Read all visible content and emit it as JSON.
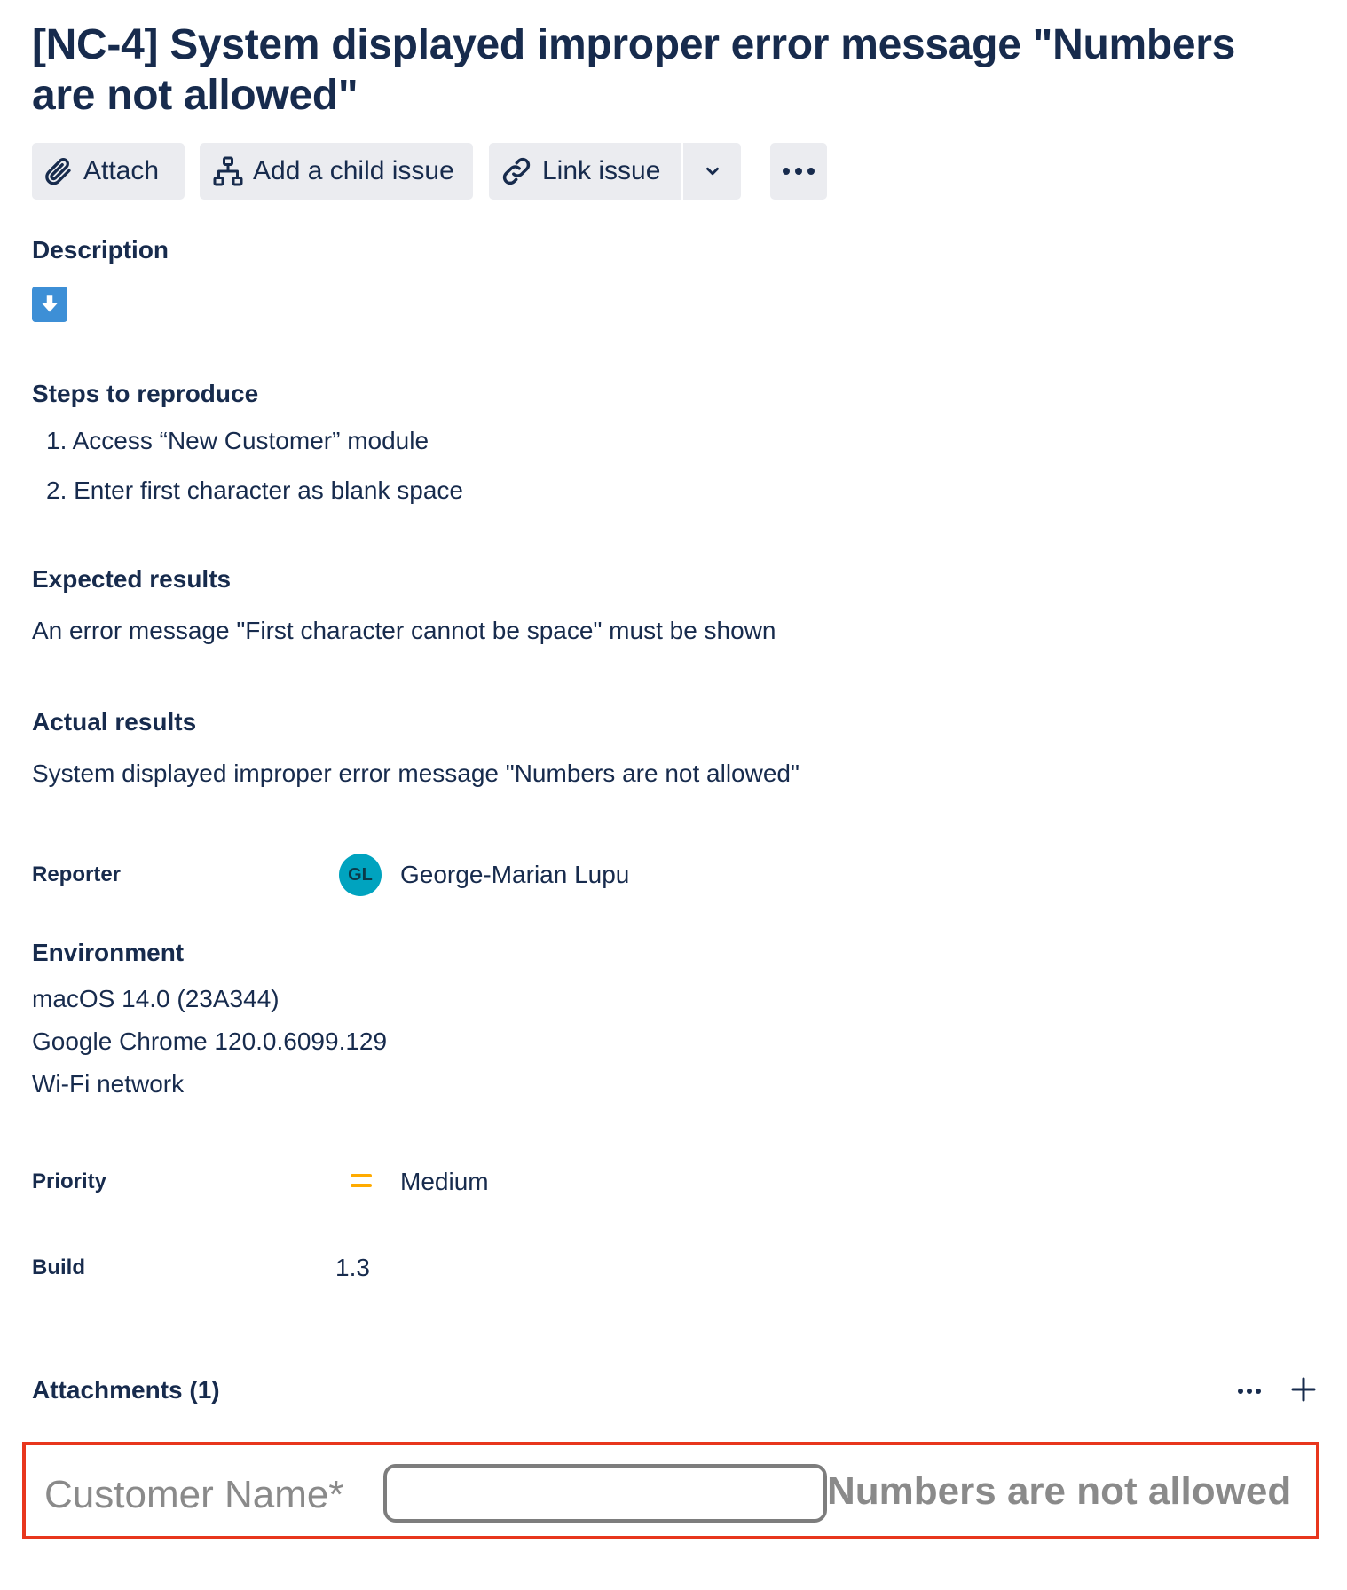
{
  "issue": {
    "title": "[NC-4] System displayed improper error message \"Numbers are not allowed\""
  },
  "toolbar": {
    "attach_label": "Attach",
    "child_label": "Add a child issue",
    "link_label": "Link issue"
  },
  "description": {
    "heading": "Description"
  },
  "steps": {
    "heading": "Steps to reproduce",
    "items": [
      "1. Access “New Customer” module",
      "2. Enter first character as blank space"
    ]
  },
  "expected": {
    "heading": "Expected results",
    "text": "An error message \"First character cannot be space\" must be shown"
  },
  "actual": {
    "heading": "Actual results",
    "text": "System displayed improper error message \"Numbers are not allowed\""
  },
  "reporter": {
    "label": "Reporter",
    "initials": "GL",
    "name": "George-Marian Lupu",
    "avatar_color": "#00a3bf"
  },
  "environment": {
    "heading": "Environment",
    "lines": [
      "macOS 14.0 (23A344)",
      "Google Chrome 120.0.6099.129",
      "Wi-Fi network"
    ]
  },
  "priority": {
    "label": "Priority",
    "value": "Medium",
    "icon_color": "#ffab00"
  },
  "build": {
    "label": "Build",
    "value": "1.3"
  },
  "attachments": {
    "heading": "Attachments (1)",
    "preview": {
      "field_label": "Customer Name*",
      "error_text": "Numbers are not allowed",
      "highlight_color": "#e8361d"
    }
  }
}
